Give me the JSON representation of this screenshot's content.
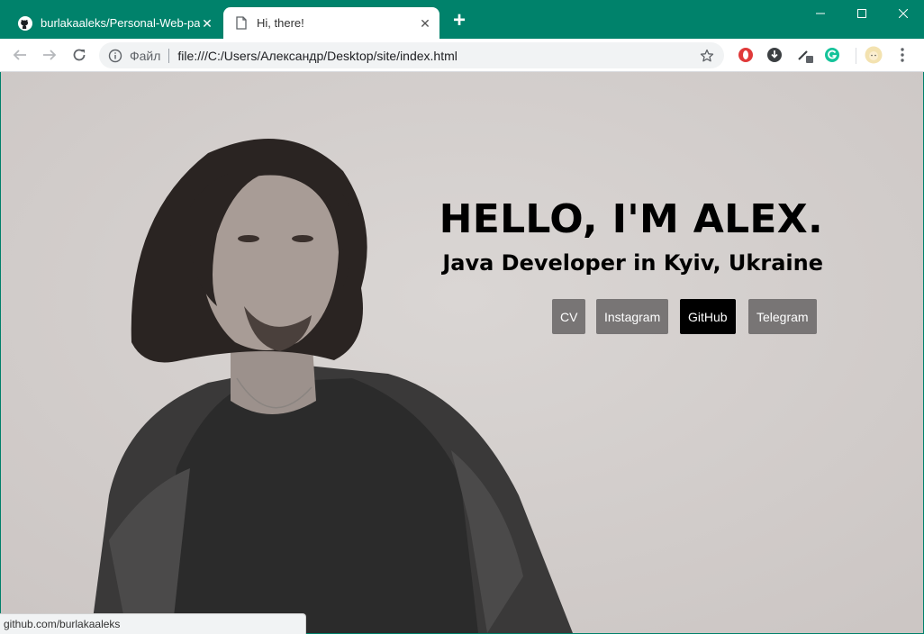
{
  "tabs": [
    {
      "title": "burlakaaleks/Personal-Web-page",
      "icon": "github-icon",
      "active": false
    },
    {
      "title": "Hi, there!",
      "icon": "page-icon",
      "active": true
    }
  ],
  "toolbar": {
    "scheme_label": "Файл",
    "url": "file:///C:/Users/Александр/Desktop/site/index.html"
  },
  "page": {
    "title": "HELLO, I'M ALEX.",
    "subtitle": "Java Developer in Kyiv, Ukraine",
    "buttons": [
      {
        "label": "CV"
      },
      {
        "label": "Instagram"
      },
      {
        "label": "GitHub"
      },
      {
        "label": "Telegram"
      }
    ]
  },
  "status_bar": {
    "text": "github.com/burlakaaleks"
  },
  "colors": {
    "chrome": "#00826b",
    "button_bg": "#787575",
    "button_active_bg": "#000000"
  }
}
